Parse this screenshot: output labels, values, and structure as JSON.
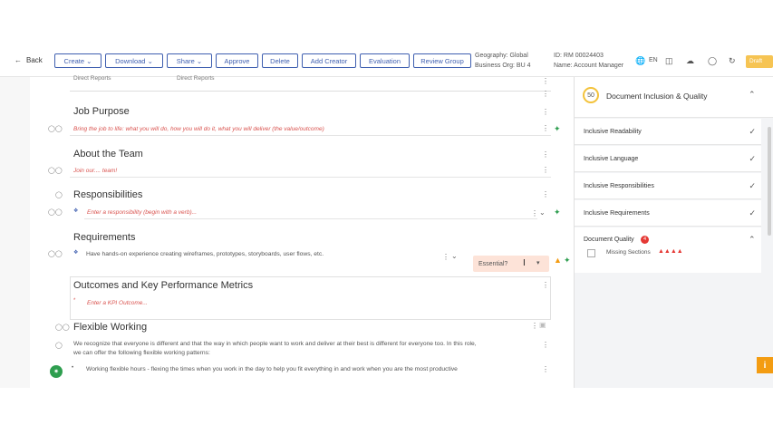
{
  "toolbar": {
    "back": "Back",
    "buttons": [
      "Create",
      "Download",
      "Share",
      "Approve",
      "Delete",
      "Add Creator",
      "Evaluation",
      "Review Group"
    ],
    "geography": "Geography: Global",
    "business_org": "Business Org: BU 4",
    "id": "ID: RM 00024403",
    "name": "Name: Account Manager",
    "language": "EN",
    "status": "Draft"
  },
  "main": {
    "direct_reports_label": "Direct Reports",
    "direct_reports_value": "Direct Reports",
    "job_purpose": {
      "title": "Job Purpose",
      "placeholder": "Bring the job to life: what you will do, how you will do it, what you will deliver (the value/outcome)"
    },
    "about_team": {
      "title": "About the Team",
      "placeholder": "Join our.... team!"
    },
    "responsibilities": {
      "title": "Responsibilities",
      "placeholder": "Enter a responsibility (begin with a verb)..."
    },
    "requirements": {
      "title": "Requirements",
      "item": "Have hands-on experience creating wireframes, prototypes, storyboards, user flows, etc.",
      "essential_label": "Essential?"
    },
    "outcomes": {
      "title": "Outcomes and Key Performance Metrics",
      "placeholder": "Enter a KPI Outcome..."
    },
    "flexible": {
      "title": "Flexible Working",
      "para1": "We recognize that everyone is different and that the way in which people want to work and deliver at their best is different for everyone too. In this role,",
      "para2": "we can offer the following flexible working patterns:",
      "bullet": "Working flexible hours - flexing the times when you work in the day to help you fit everything in and work when you are the most productive"
    }
  },
  "panel": {
    "score": "50",
    "title": "Document Inclusion & Quality",
    "items": [
      "Inclusive Readability",
      "Inclusive Language",
      "Inclusive Responsibilities",
      "Inclusive Requirements"
    ],
    "quality_title": "Document Quality",
    "quality_count": "4",
    "missing_sections": "Missing Sections"
  },
  "colors": {
    "accent": "#3f5fb0",
    "warning": "#e53935",
    "draft": "#f6c453"
  }
}
